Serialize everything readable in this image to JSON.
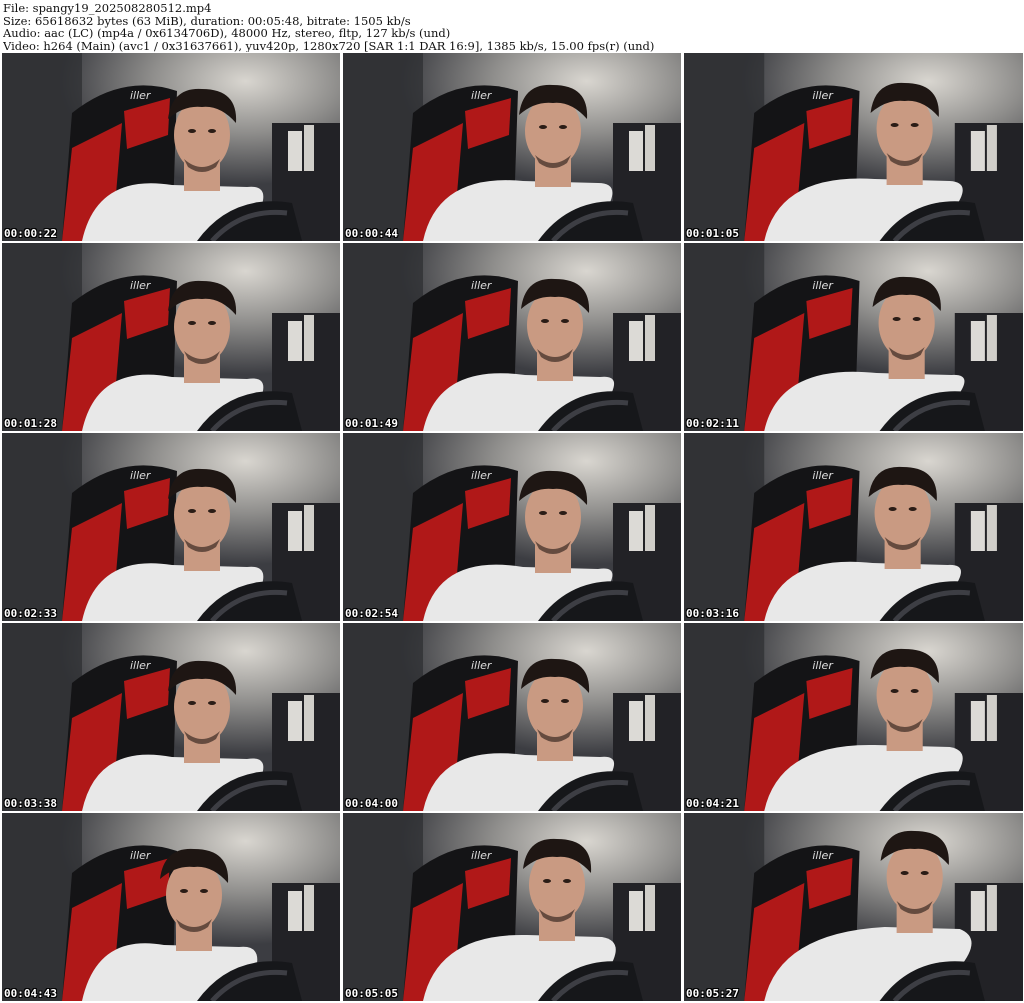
{
  "header": {
    "file": "File: spangy19_202508280512.mp4",
    "size": "Size: 65618632 bytes (63 MiB), duration: 00:05:48, bitrate: 1505 kb/s",
    "audio": "Audio: aac (LC) (mp4a / 0x6134706D), 48000 Hz, stereo, fltp, 127 kb/s (und)",
    "video": "Video: h264 (Main) (avc1 / 0x31637661), yuv420p, 1280x720 [SAR 1:1 DAR 16:9], 1385 kb/s, 15.00 fps(r) (und)"
  },
  "thumbnails": [
    {
      "timestamp": "00:00:22"
    },
    {
      "timestamp": "00:00:44"
    },
    {
      "timestamp": "00:01:05"
    },
    {
      "timestamp": "00:01:28"
    },
    {
      "timestamp": "00:01:49"
    },
    {
      "timestamp": "00:02:11"
    },
    {
      "timestamp": "00:02:33"
    },
    {
      "timestamp": "00:02:54"
    },
    {
      "timestamp": "00:03:16"
    },
    {
      "timestamp": "00:03:38"
    },
    {
      "timestamp": "00:04:00"
    },
    {
      "timestamp": "00:04:21"
    },
    {
      "timestamp": "00:04:43"
    },
    {
      "timestamp": "00:05:05"
    },
    {
      "timestamp": "00:05:27"
    }
  ],
  "scene_text": {
    "chair_logo": "iller"
  },
  "colors": {
    "wall": "#3c3d42",
    "light": "#d9d6d0",
    "chair_red": "#b01818",
    "chair_black": "#141416",
    "shirt": "#e8e8e8",
    "skin": "#c99a82",
    "hair": "#1e1613"
  }
}
